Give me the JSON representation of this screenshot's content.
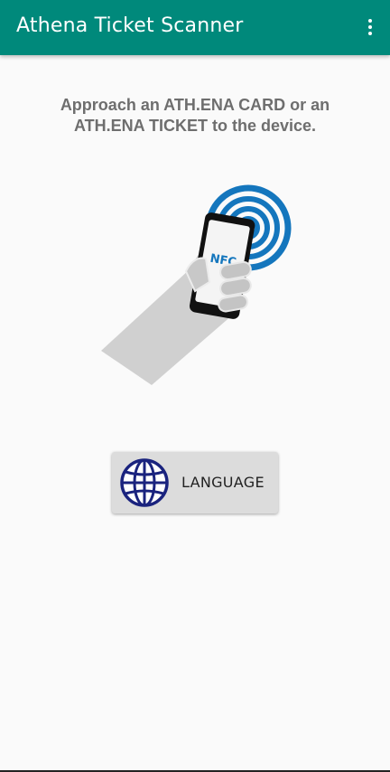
{
  "app_bar": {
    "title": "Athena Ticket Scanner",
    "background_color": "#00897b",
    "menu_icon": "more-vert-icon"
  },
  "main": {
    "instruction_line1": "Approach an ATH.ENA CARD or an",
    "instruction_line2": "ATH.ENA TICKET to the device.",
    "illustration": {
      "icon": "nfc-phone-hand-icon",
      "phone_label": "NFC",
      "wave_color": "#1476bd"
    },
    "language_button": {
      "label": "LANGUAGE",
      "icon": "globe-icon",
      "globe_color": "#1a237e"
    }
  }
}
